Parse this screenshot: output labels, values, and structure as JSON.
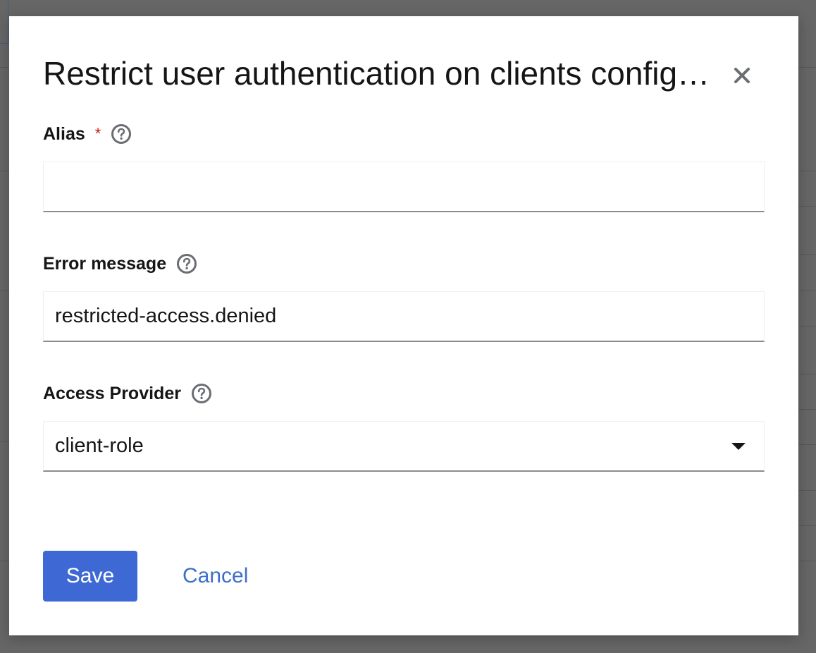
{
  "modal": {
    "title": "Restrict user authentication on clients configuration"
  },
  "form": {
    "alias": {
      "label": "Alias",
      "required_marker": "*",
      "value": ""
    },
    "error_message": {
      "label": "Error message",
      "value": "restricted-access.denied"
    },
    "access_provider": {
      "label": "Access Provider",
      "selected": "client-role"
    }
  },
  "actions": {
    "save_label": "Save",
    "cancel_label": "Cancel"
  },
  "icons": {
    "close": "close-icon",
    "help": "help-circle-icon",
    "caret": "caret-down-icon"
  },
  "colors": {
    "primary": "#3e69d4",
    "link": "#3e6fc7",
    "required": "#c9190b",
    "overlay": "#666666"
  }
}
